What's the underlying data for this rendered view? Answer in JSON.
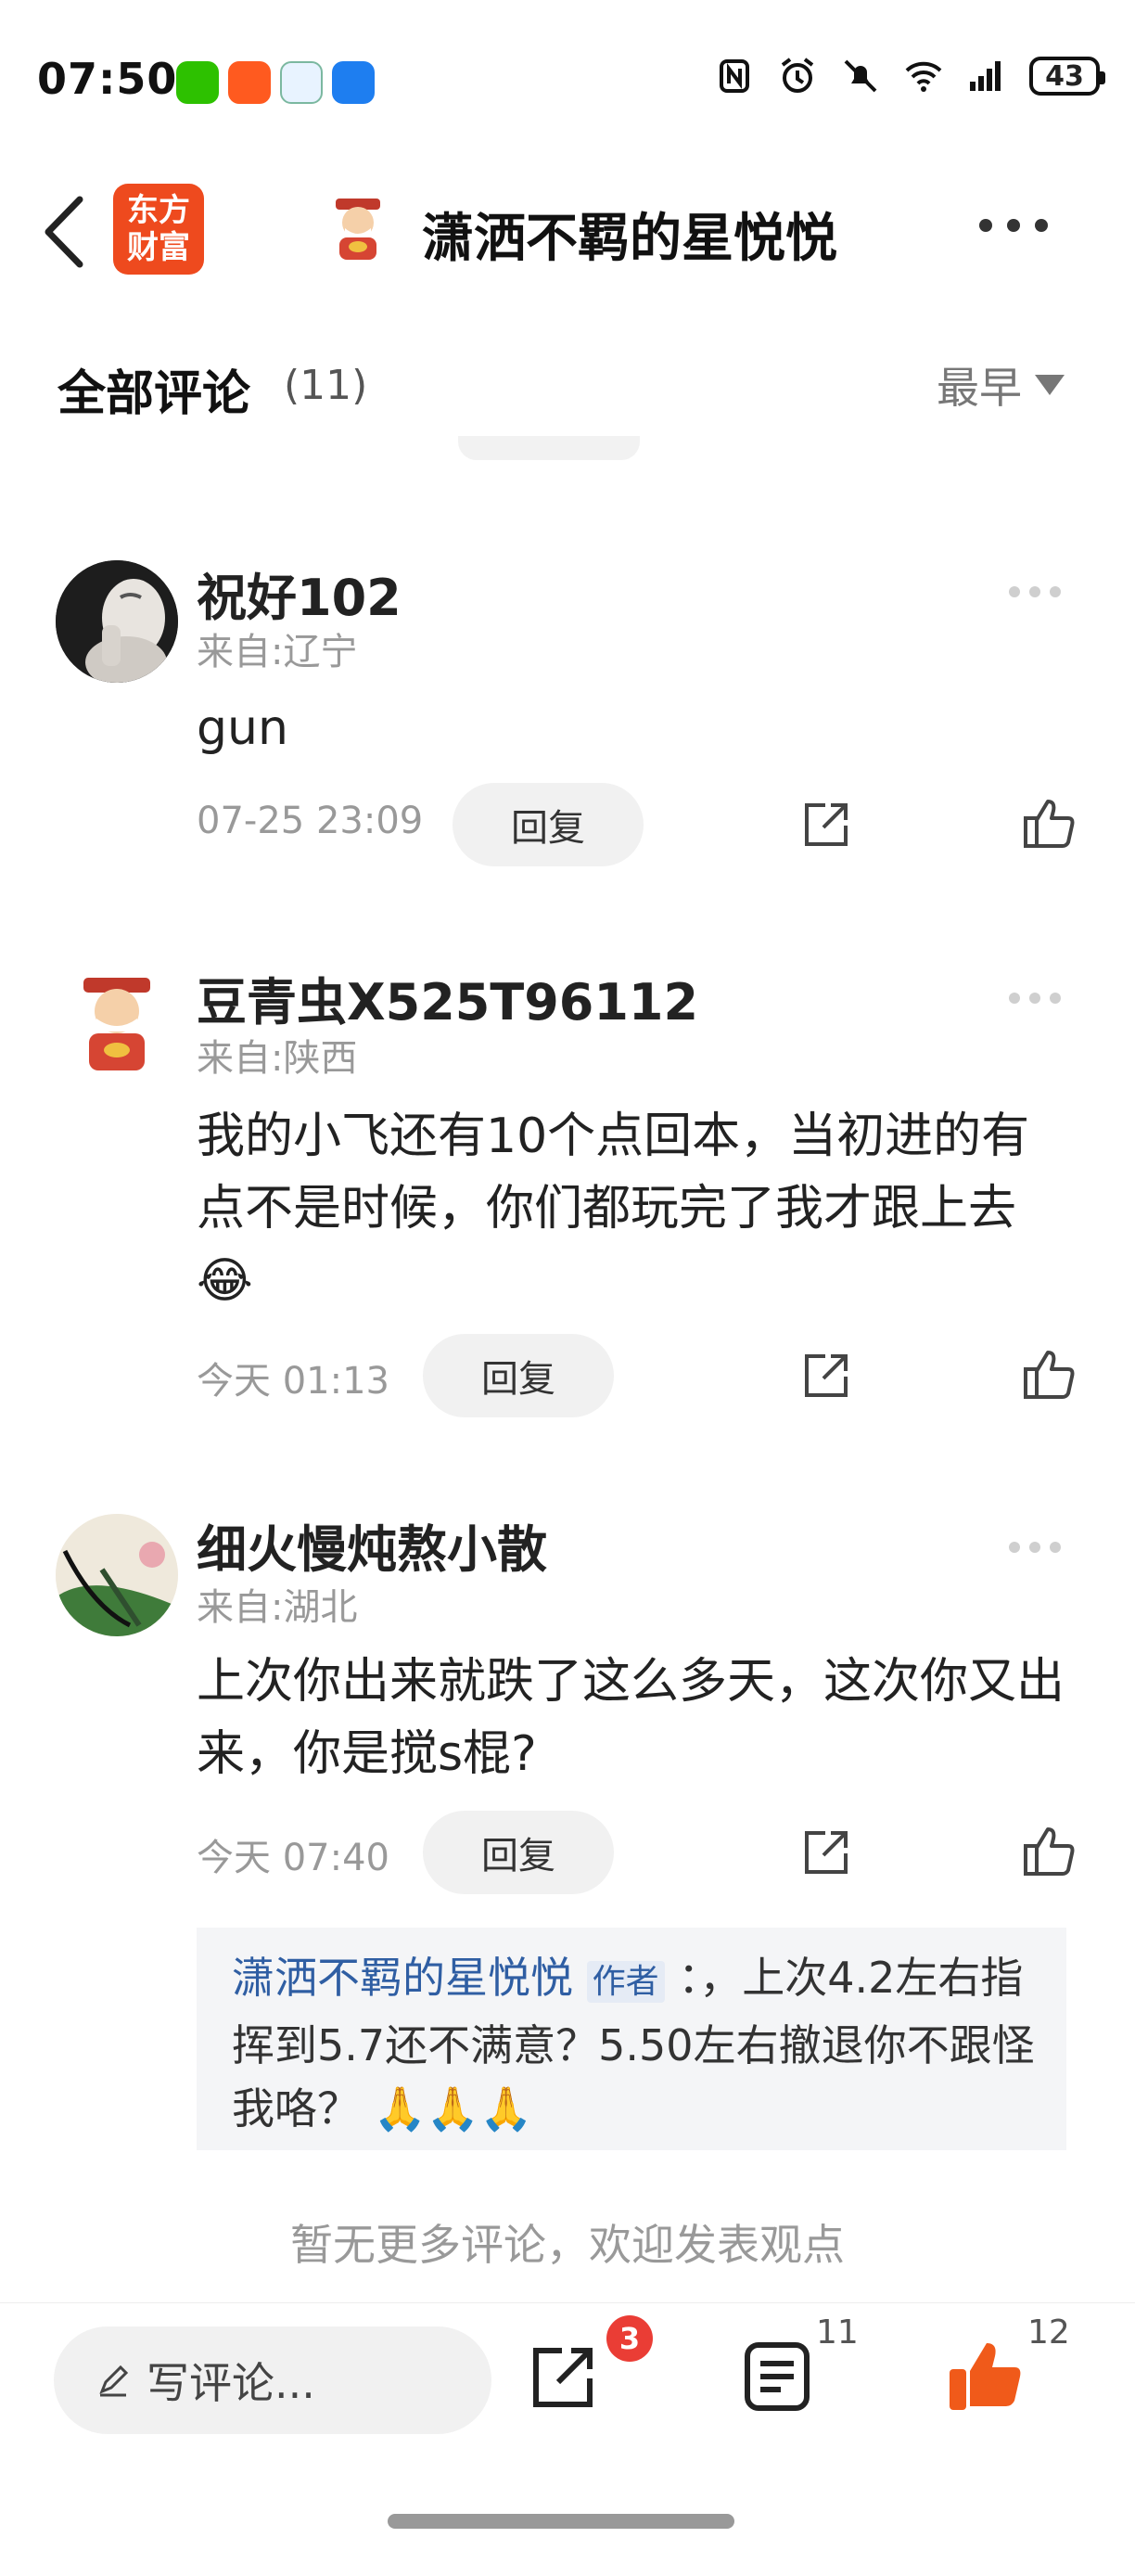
{
  "status_bar": {
    "time": "07:50",
    "battery": "43"
  },
  "header": {
    "logo_text": "东方财富",
    "logo_line1": "东方",
    "logo_line2": "财富",
    "title": "潇洒不羁的星悦悦"
  },
  "filter": {
    "label": "全部评论",
    "count": "(11)",
    "sort": "最早"
  },
  "comments": [
    {
      "name": "祝好102",
      "location": "来自:辽宁",
      "text": "gun",
      "time": "07-25 23:09",
      "reply_label": "回复"
    },
    {
      "name": "豆青虫X525T96112",
      "location": "来自:陕西",
      "text": "我的小飞还有10个点回本，当初进的有点不是时候，你们都玩完了我才跟上去😂",
      "time": "今天 01:13",
      "reply_label": "回复"
    },
    {
      "name": "细火慢炖熬小散",
      "location": "来自:湖北",
      "text": "上次你出来就跌了这么多天，这次你又出来，你是搅s棍?",
      "time": "今天 07:40",
      "reply_label": "回复"
    }
  ],
  "author_reply": {
    "name": "潇洒不羁的星悦悦",
    "badge": "作者",
    "text": "：，上次4.2左右指挥到5.7还不满意？5.50左右撤退你不跟怪我咯？",
    "emoji": "🙏🙏🙏"
  },
  "footer_note": "暂无更多评论，欢迎发表观点",
  "bottom_bar": {
    "write_placeholder": "写评论...",
    "share_badge": "3",
    "comment_count": "11",
    "like_count": "12"
  },
  "colors": {
    "brand": "#ee4a1e",
    "like_active": "#f05a1a",
    "badge": "#ea3d35",
    "author_link": "#2f5ea3"
  },
  "icons": [
    "back-icon",
    "more-icon",
    "share-icon",
    "like-icon",
    "pencil-icon",
    "list-icon",
    "sort-triangle-icon"
  ]
}
